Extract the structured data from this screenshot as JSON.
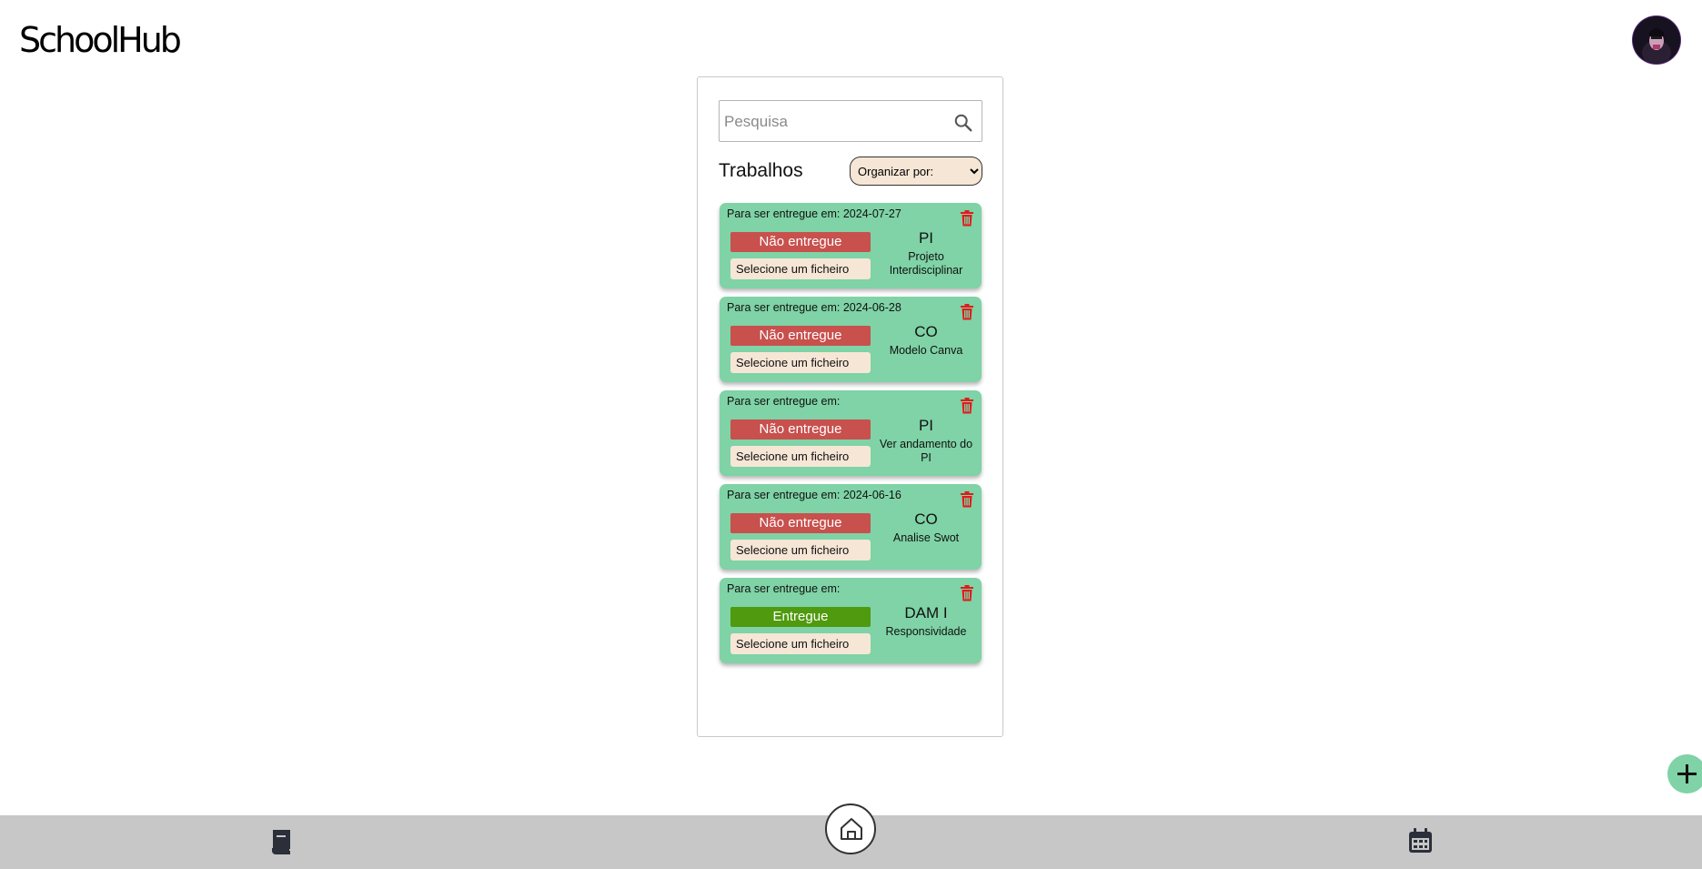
{
  "header": {
    "logo_text": "SchoolHub"
  },
  "search": {
    "placeholder": "Pesquisa"
  },
  "section": {
    "title": "Trabalhos",
    "sort_label": "Organizar por:"
  },
  "assignments": [
    {
      "due": "Para ser entregue em: 2024-07-27",
      "status": "Não entregue",
      "status_kind": "not-delivered",
      "file_label": "Selecione um ficheiro",
      "subject": "PI",
      "description": "Projeto Interdisciplinar"
    },
    {
      "due": "Para ser entregue em: 2024-06-28",
      "status": "Não entregue",
      "status_kind": "not-delivered",
      "file_label": "Selecione um ficheiro",
      "subject": "CO",
      "description": "Modelo Canva"
    },
    {
      "due": "Para ser entregue em:",
      "status": "Não entregue",
      "status_kind": "not-delivered",
      "file_label": "Selecione um ficheiro",
      "subject": "PI",
      "description": "Ver andamento do PI"
    },
    {
      "due": "Para ser entregue em: 2024-06-16",
      "status": "Não entregue",
      "status_kind": "not-delivered",
      "file_label": "Selecione um ficheiro",
      "subject": "CO",
      "description": "Analise Swot"
    },
    {
      "due": "Para ser entregue em:",
      "status": "Entregue",
      "status_kind": "delivered",
      "file_label": "Selecione um ficheiro",
      "subject": "DAM I",
      "description": "Responsividade"
    }
  ],
  "icons": {
    "search": "search-icon",
    "trash": "trash-icon",
    "add": "plus-icon",
    "book": "book-icon",
    "home": "home-icon",
    "calendar": "calendar-icon",
    "avatar": "avatar"
  },
  "colors": {
    "card_bg": "#7fd3a6",
    "not_delivered": "#c8504d",
    "delivered": "#4f9a0e",
    "file_bg": "#f6e6d6",
    "trash": "#e01b1b",
    "bottom_bar": "#c7c7c7"
  }
}
